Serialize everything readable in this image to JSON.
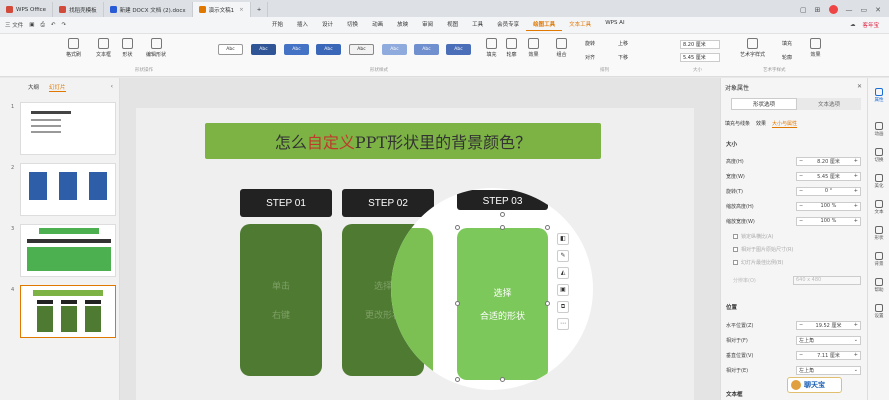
{
  "titlebar": {
    "tabs": [
      {
        "label": "WPS Office",
        "color": "#d24a3a"
      },
      {
        "label": "找稻壳模板",
        "color": "#d24a3a"
      },
      {
        "label": "新建 DOCX 文档 (2).docx",
        "color": "#2a5bd7"
      },
      {
        "label": "演示文稿1",
        "color": "#e07800",
        "active": true
      }
    ],
    "new_tab": "+"
  },
  "menubar": {
    "file": "三 文件",
    "items": [
      "开始",
      "插入",
      "设计",
      "切换",
      "动画",
      "放映",
      "审阅",
      "视图",
      "工具",
      "会员专享",
      "绘图工具",
      "文本工具"
    ],
    "active": "绘图工具",
    "wps_ai": "WPS AI",
    "ads_label": "客年宝"
  },
  "ribbon": {
    "buttons": [
      "格式刷",
      "文本框",
      "形状",
      "编辑形状",
      "形状样式",
      "填充",
      "轮廓",
      "效果",
      "组合",
      "对齐",
      "旋转",
      "选择窗格",
      "上移",
      "下移",
      "艺术字样式",
      "填充",
      "轮廓",
      "效果"
    ],
    "style_samples": [
      "Abc",
      "Abc",
      "Abc",
      "Abc",
      "Abc",
      "Abc",
      "Abc",
      "Abc"
    ],
    "groups": [
      "形状操作",
      "形状样式",
      "排列",
      "大小",
      "艺术字样式"
    ],
    "height_value": "8.20 厘米",
    "width_value": "5.45 厘米"
  },
  "leftpane": {
    "tabs": [
      "大纲",
      "幻灯片"
    ],
    "active": "幻灯片",
    "slide_numbers": [
      "1",
      "2",
      "3",
      "4"
    ]
  },
  "slide": {
    "title_pre": "怎么",
    "title_red": "自定义",
    "title_post": "PPT形状里的背景颜色？",
    "steps": [
      "STEP 01",
      "STEP 02",
      "STEP 03"
    ],
    "card1": [
      "单击",
      "右键"
    ],
    "card2": [
      "选择",
      "更改形状"
    ],
    "card3": [
      "选择",
      "合适的形状"
    ]
  },
  "rightpane": {
    "title": "对象属性",
    "seg": [
      "形状选项",
      "文本选项"
    ],
    "subtabs": [
      "填充与线条",
      "效果",
      "大小与属性"
    ],
    "size_section": "大小",
    "rows": [
      {
        "label": "高度(H)",
        "value": "8.20 厘米"
      },
      {
        "label": "宽度(W)",
        "value": "5.45 厘米"
      },
      {
        "label": "旋转(T)",
        "value": "0 °"
      },
      {
        "label": "缩放高度(H)",
        "value": "100 %"
      },
      {
        "label": "缩放宽度(W)",
        "value": "100 %"
      }
    ],
    "lock_ratio": "锁定纵横比(A)",
    "relative_original": "相对于图片原始尺寸(R)",
    "best_scale": "幻灯片最佳比例(B)",
    "resolution_label": "分辨率(O)",
    "resolution_value": "640 x 480",
    "position_section": "位置",
    "pos_rows": [
      {
        "label": "水平位置(Z)",
        "value": "19.52 厘米"
      },
      {
        "label": "相对于(F)",
        "value": "左上角"
      },
      {
        "label": "垂直位置(V)",
        "value": "7.11 厘米"
      },
      {
        "label": "相对于(E)",
        "value": "左上角"
      }
    ],
    "textbox_section": "文本框"
  },
  "farright": [
    "属性",
    "动画",
    "切换",
    "美化",
    "文本",
    "形状",
    "背景",
    "帮助",
    "设置"
  ],
  "watermark": "聊天宝"
}
